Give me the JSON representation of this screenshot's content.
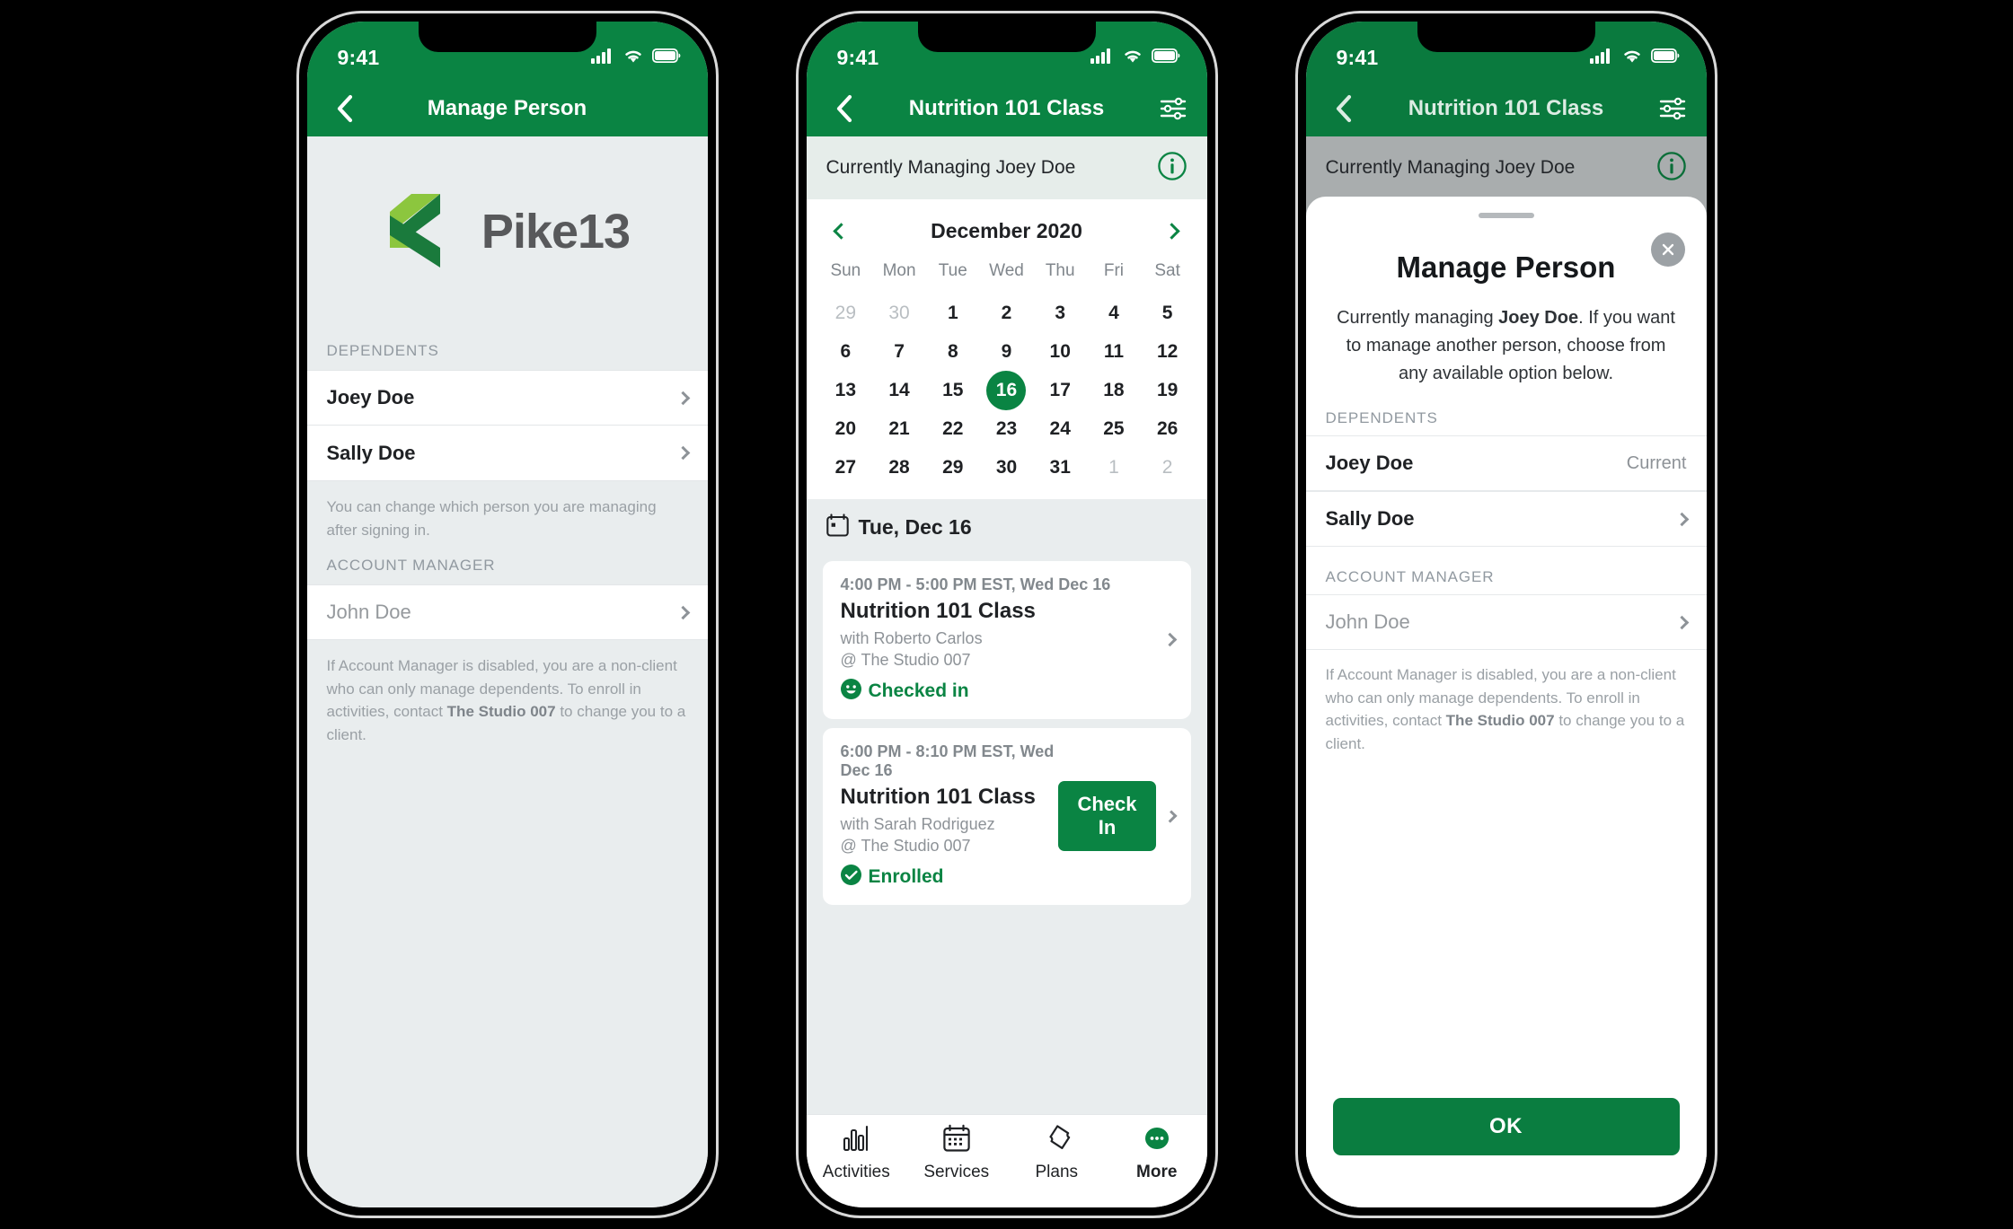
{
  "colors": {
    "brand_green": "#0a8443",
    "logo_dark_green": "#1a7a3c",
    "logo_light_green": "#8cc63e",
    "logo_text_gray": "#58595b",
    "screen_bg": "#e9edee",
    "managing_bar_bg": "#e6edea"
  },
  "status_bar": {
    "time": "9:41",
    "cell_icon": "cell-signal-icon",
    "wifi_icon": "wifi-icon",
    "battery_icon": "battery-icon"
  },
  "phone1": {
    "navbar": {
      "back_icon": "chevron-left-icon",
      "title": "Manage Person"
    },
    "logo": {
      "mark_icon": "pike13-logo-mark",
      "wordmark": "Pike13"
    },
    "dependents_label": "DEPENDENTS",
    "dependents": [
      {
        "name": "Joey Doe",
        "chevron_icon": "chevron-right-icon"
      },
      {
        "name": "Sally Doe",
        "chevron_icon": "chevron-right-icon"
      }
    ],
    "dependents_helper": "You can change which person you are managing after signing in.",
    "account_manager_label": "ACCOUNT MANAGER",
    "account_manager": {
      "name": "John Doe",
      "chevron_icon": "chevron-right-icon"
    },
    "account_manager_helper_1": "If Account Manager is disabled, you are a non-client who can only manage dependents. To enroll in activities, contact ",
    "account_manager_helper_bold": "The Studio 007",
    "account_manager_helper_2": " to change you to a client."
  },
  "phone2": {
    "navbar": {
      "back_icon": "chevron-left-icon",
      "title": "Nutrition 101 Class",
      "filter_icon": "sliders-filter-icon"
    },
    "managing": {
      "text": "Currently Managing Joey Doe",
      "info_icon": "info-circle-icon"
    },
    "calendar": {
      "prev_icon": "chevron-left-icon",
      "next_icon": "chevron-right-icon",
      "month_title": "December 2020",
      "day_names": [
        "Sun",
        "Mon",
        "Tue",
        "Wed",
        "Thu",
        "Fri",
        "Sat"
      ],
      "weeks": [
        [
          {
            "d": "29",
            "out": true
          },
          {
            "d": "30",
            "out": true
          },
          {
            "d": "1"
          },
          {
            "d": "2"
          },
          {
            "d": "3"
          },
          {
            "d": "4"
          },
          {
            "d": "5"
          }
        ],
        [
          {
            "d": "6"
          },
          {
            "d": "7"
          },
          {
            "d": "8"
          },
          {
            "d": "9"
          },
          {
            "d": "10"
          },
          {
            "d": "11"
          },
          {
            "d": "12"
          }
        ],
        [
          {
            "d": "13"
          },
          {
            "d": "14"
          },
          {
            "d": "15"
          },
          {
            "d": "16",
            "selected": true
          },
          {
            "d": "17"
          },
          {
            "d": "18"
          },
          {
            "d": "19"
          }
        ],
        [
          {
            "d": "20"
          },
          {
            "d": "21"
          },
          {
            "d": "22"
          },
          {
            "d": "23"
          },
          {
            "d": "24"
          },
          {
            "d": "25"
          },
          {
            "d": "26"
          }
        ],
        [
          {
            "d": "27"
          },
          {
            "d": "28"
          },
          {
            "d": "29"
          },
          {
            "d": "30"
          },
          {
            "d": "31"
          },
          {
            "d": "1",
            "out": true
          },
          {
            "d": "2",
            "out": true
          }
        ]
      ],
      "selected_day": "16"
    },
    "agenda": {
      "calendar_icon": "calendar-icon",
      "date_header": "Tue, Dec 16",
      "events": [
        {
          "time": "4:00 PM - 5:00 PM EST, Wed Dec 16",
          "title": "Nutrition 101 Class",
          "instructor": "with Roberto Carlos",
          "location": "@ The Studio 007",
          "status_icon": "smiley-face-icon",
          "status": "Checked in",
          "has_button": false,
          "chevron_icon": "chevron-right-icon"
        },
        {
          "time": "6:00 PM - 8:10 PM EST, Wed Dec 16",
          "title": "Nutrition 101 Class",
          "instructor": "with Sarah Rodriguez",
          "location": "@ The Studio 007",
          "status_icon": "check-circle-icon",
          "status": "Enrolled",
          "has_button": true,
          "button_label": "Check In",
          "chevron_icon": "chevron-right-icon"
        }
      ]
    },
    "tabbar": [
      {
        "label": "Activities",
        "icon": "bar-chart-icon",
        "active": false
      },
      {
        "label": "Services",
        "icon": "calendar-icon",
        "active": false
      },
      {
        "label": "Plans",
        "icon": "ticket-icon",
        "active": false
      },
      {
        "label": "More",
        "icon": "more-dots-icon",
        "active": true
      }
    ]
  },
  "phone3": {
    "navbar": {
      "back_icon": "chevron-left-icon",
      "title": "Nutrition 101 Class",
      "filter_icon": "sliders-filter-icon"
    },
    "managing": {
      "text": "Currently Managing Joey Doe",
      "info_icon": "info-circle-icon"
    },
    "sheet": {
      "grabber": "drag-handle",
      "close_icon": "close-x-icon",
      "title": "Manage Person",
      "desc_1": "Currently managing ",
      "desc_bold": "Joey Doe",
      "desc_2": ". If you want to manage another person, choose from any available option below.",
      "dependents_label": "DEPENDENTS",
      "dependents": [
        {
          "name": "Joey Doe",
          "meta": "Current",
          "chevron_icon": ""
        },
        {
          "name": "Sally Doe",
          "meta": "",
          "chevron_icon": "chevron-right-icon"
        }
      ],
      "account_manager_label": "ACCOUNT MANAGER",
      "account_manager": {
        "name": "John Doe",
        "chevron_icon": "chevron-right-icon"
      },
      "helper_1": "If Account Manager is disabled, you are a non-client who can only manage dependents. To enroll in activities, contact ",
      "helper_bold": "The Studio 007",
      "helper_2": " to change you to a client.",
      "ok_label": "OK"
    }
  }
}
